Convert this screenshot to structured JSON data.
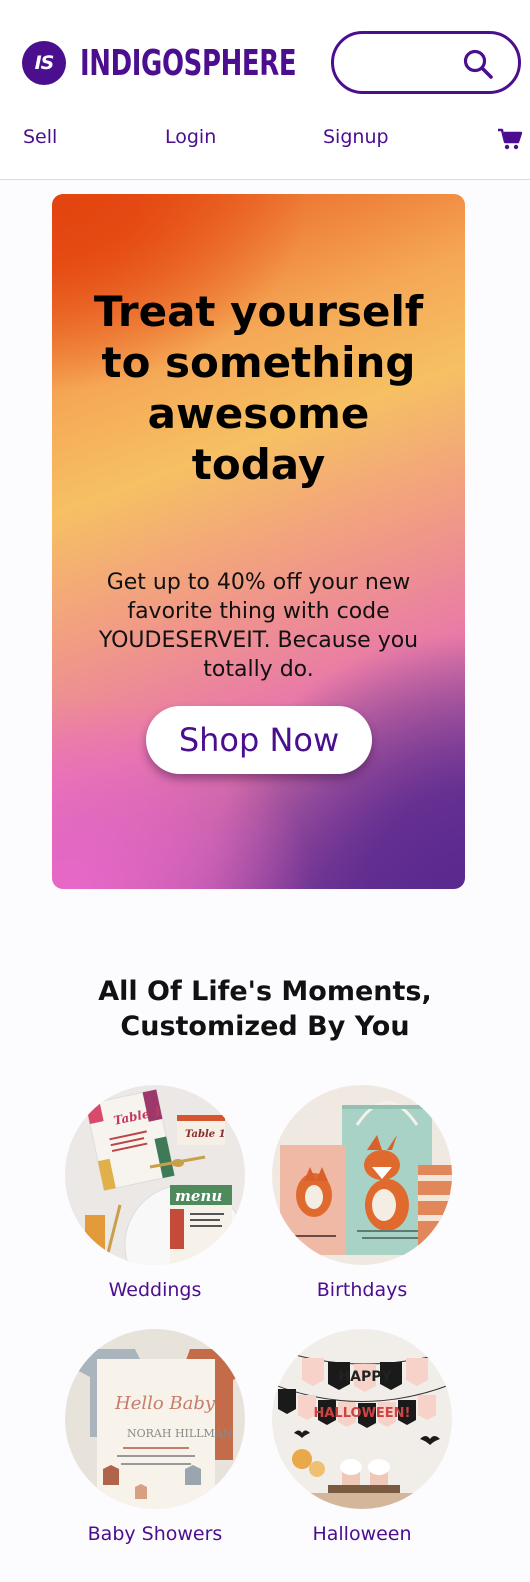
{
  "brand": {
    "mark": "IS",
    "name": "INDIGOSPHERE"
  },
  "search": {
    "placeholder": ""
  },
  "nav": {
    "sell": "Sell",
    "login": "Login",
    "signup": "Signup"
  },
  "icons": {
    "search": "search-icon",
    "cart": "cart-icon"
  },
  "colors": {
    "brand": "#4a0e8f"
  },
  "hero": {
    "title": "Treat yourself to something awesome today",
    "text": "Get up to 40% off your new favorite thing with code YOUDESERVEIT. Because you totally do.",
    "cta": "Shop Now"
  },
  "moments": {
    "title": "All Of Life's Moments, Customized By You",
    "items": [
      {
        "label": "Weddings",
        "card_text_1": "Table 1",
        "card_text_2": "menu"
      },
      {
        "label": "Birthdays"
      },
      {
        "label": "Baby Showers",
        "card_text_1": "Hello Baby",
        "card_text_2": "NORAH HILLMAN"
      },
      {
        "label": "Halloween",
        "banner_top": "HAPPY",
        "banner_bottom": "HALLOWEEN!"
      }
    ]
  }
}
